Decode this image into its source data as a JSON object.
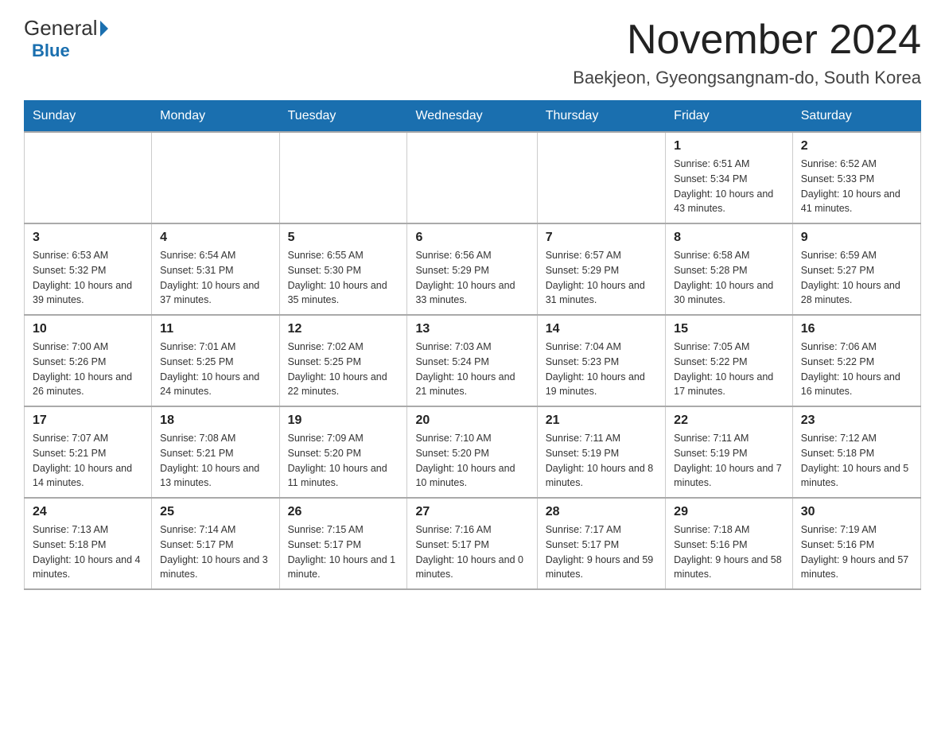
{
  "logo": {
    "general": "General",
    "blue": "Blue",
    "tagline": "Blue"
  },
  "header": {
    "month_title": "November 2024",
    "location": "Baekjeon, Gyeongsangnam-do, South Korea"
  },
  "days_of_week": [
    "Sunday",
    "Monday",
    "Tuesday",
    "Wednesday",
    "Thursday",
    "Friday",
    "Saturday"
  ],
  "weeks": [
    [
      {
        "day": "",
        "info": ""
      },
      {
        "day": "",
        "info": ""
      },
      {
        "day": "",
        "info": ""
      },
      {
        "day": "",
        "info": ""
      },
      {
        "day": "",
        "info": ""
      },
      {
        "day": "1",
        "info": "Sunrise: 6:51 AM\nSunset: 5:34 PM\nDaylight: 10 hours and 43 minutes."
      },
      {
        "day": "2",
        "info": "Sunrise: 6:52 AM\nSunset: 5:33 PM\nDaylight: 10 hours and 41 minutes."
      }
    ],
    [
      {
        "day": "3",
        "info": "Sunrise: 6:53 AM\nSunset: 5:32 PM\nDaylight: 10 hours and 39 minutes."
      },
      {
        "day": "4",
        "info": "Sunrise: 6:54 AM\nSunset: 5:31 PM\nDaylight: 10 hours and 37 minutes."
      },
      {
        "day": "5",
        "info": "Sunrise: 6:55 AM\nSunset: 5:30 PM\nDaylight: 10 hours and 35 minutes."
      },
      {
        "day": "6",
        "info": "Sunrise: 6:56 AM\nSunset: 5:29 PM\nDaylight: 10 hours and 33 minutes."
      },
      {
        "day": "7",
        "info": "Sunrise: 6:57 AM\nSunset: 5:29 PM\nDaylight: 10 hours and 31 minutes."
      },
      {
        "day": "8",
        "info": "Sunrise: 6:58 AM\nSunset: 5:28 PM\nDaylight: 10 hours and 30 minutes."
      },
      {
        "day": "9",
        "info": "Sunrise: 6:59 AM\nSunset: 5:27 PM\nDaylight: 10 hours and 28 minutes."
      }
    ],
    [
      {
        "day": "10",
        "info": "Sunrise: 7:00 AM\nSunset: 5:26 PM\nDaylight: 10 hours and 26 minutes."
      },
      {
        "day": "11",
        "info": "Sunrise: 7:01 AM\nSunset: 5:25 PM\nDaylight: 10 hours and 24 minutes."
      },
      {
        "day": "12",
        "info": "Sunrise: 7:02 AM\nSunset: 5:25 PM\nDaylight: 10 hours and 22 minutes."
      },
      {
        "day": "13",
        "info": "Sunrise: 7:03 AM\nSunset: 5:24 PM\nDaylight: 10 hours and 21 minutes."
      },
      {
        "day": "14",
        "info": "Sunrise: 7:04 AM\nSunset: 5:23 PM\nDaylight: 10 hours and 19 minutes."
      },
      {
        "day": "15",
        "info": "Sunrise: 7:05 AM\nSunset: 5:22 PM\nDaylight: 10 hours and 17 minutes."
      },
      {
        "day": "16",
        "info": "Sunrise: 7:06 AM\nSunset: 5:22 PM\nDaylight: 10 hours and 16 minutes."
      }
    ],
    [
      {
        "day": "17",
        "info": "Sunrise: 7:07 AM\nSunset: 5:21 PM\nDaylight: 10 hours and 14 minutes."
      },
      {
        "day": "18",
        "info": "Sunrise: 7:08 AM\nSunset: 5:21 PM\nDaylight: 10 hours and 13 minutes."
      },
      {
        "day": "19",
        "info": "Sunrise: 7:09 AM\nSunset: 5:20 PM\nDaylight: 10 hours and 11 minutes."
      },
      {
        "day": "20",
        "info": "Sunrise: 7:10 AM\nSunset: 5:20 PM\nDaylight: 10 hours and 10 minutes."
      },
      {
        "day": "21",
        "info": "Sunrise: 7:11 AM\nSunset: 5:19 PM\nDaylight: 10 hours and 8 minutes."
      },
      {
        "day": "22",
        "info": "Sunrise: 7:11 AM\nSunset: 5:19 PM\nDaylight: 10 hours and 7 minutes."
      },
      {
        "day": "23",
        "info": "Sunrise: 7:12 AM\nSunset: 5:18 PM\nDaylight: 10 hours and 5 minutes."
      }
    ],
    [
      {
        "day": "24",
        "info": "Sunrise: 7:13 AM\nSunset: 5:18 PM\nDaylight: 10 hours and 4 minutes."
      },
      {
        "day": "25",
        "info": "Sunrise: 7:14 AM\nSunset: 5:17 PM\nDaylight: 10 hours and 3 minutes."
      },
      {
        "day": "26",
        "info": "Sunrise: 7:15 AM\nSunset: 5:17 PM\nDaylight: 10 hours and 1 minute."
      },
      {
        "day": "27",
        "info": "Sunrise: 7:16 AM\nSunset: 5:17 PM\nDaylight: 10 hours and 0 minutes."
      },
      {
        "day": "28",
        "info": "Sunrise: 7:17 AM\nSunset: 5:17 PM\nDaylight: 9 hours and 59 minutes."
      },
      {
        "day": "29",
        "info": "Sunrise: 7:18 AM\nSunset: 5:16 PM\nDaylight: 9 hours and 58 minutes."
      },
      {
        "day": "30",
        "info": "Sunrise: 7:19 AM\nSunset: 5:16 PM\nDaylight: 9 hours and 57 minutes."
      }
    ]
  ]
}
